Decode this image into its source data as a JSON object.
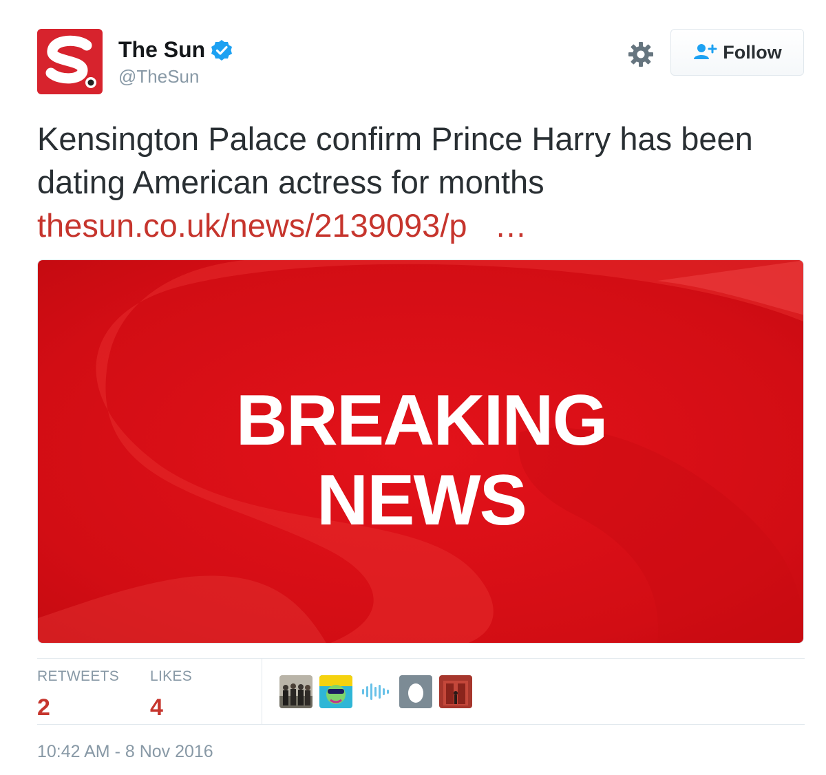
{
  "account": {
    "name": "The Sun",
    "handle": "@TheSun"
  },
  "follow_button": {
    "label": "Follow"
  },
  "tweet": {
    "text": "Kensington Palace confirm Prince Harry has been dating American actress for months",
    "link": "thesun.co.uk/news/2139093/p",
    "ellipsis": "…"
  },
  "media": {
    "line1": "BREAKING",
    "line2": "NEWS"
  },
  "stats": {
    "retweets_label": "RETWEETS",
    "retweets_value": "2",
    "likes_label": "LIKES",
    "likes_value": "4"
  },
  "likers": [
    "avatar-group-photo",
    "avatar-colorful-face",
    "avatar-soundwave",
    "avatar-egg",
    "avatar-red-room"
  ],
  "timestamp": "10:42 AM - 8 Nov 2016",
  "colors": {
    "brand_red": "#c6352d",
    "verified_blue": "#1da1f2",
    "muted_gray": "#8899a6"
  }
}
